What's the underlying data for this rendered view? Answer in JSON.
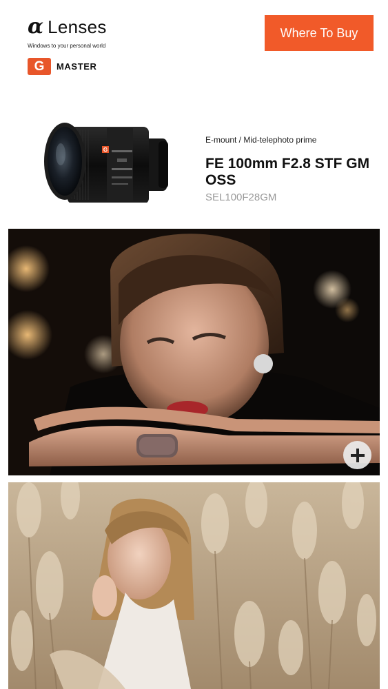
{
  "header": {
    "brand_name": "Lenses",
    "tagline": "Windows to your personal world",
    "gm_badge_letter": "G",
    "gm_label": "MASTER",
    "cta_label": "Where To Buy"
  },
  "product": {
    "mount": "E-mount / Mid-telephoto prime",
    "name": "FE 100mm F2.8 STF GM OSS",
    "model": "SEL100F28GM",
    "lens_badge_letter": "G"
  },
  "gallery": {
    "zoom_icon": "plus-icon"
  },
  "colors": {
    "accent": "#f15a29",
    "gm_badge": "#e8562a",
    "muted_text": "#9a9a9a"
  }
}
